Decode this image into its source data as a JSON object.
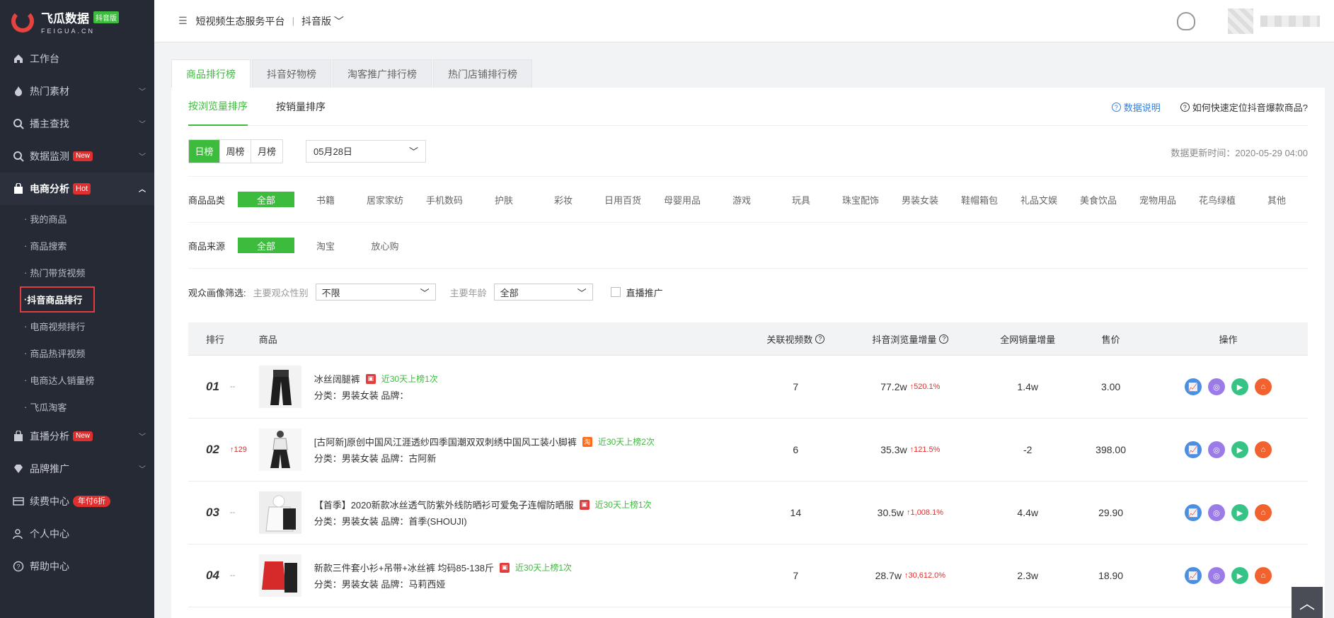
{
  "logo": {
    "title": "飞瓜数据",
    "badge": "抖音版",
    "sub": "FEIGUA.CN"
  },
  "sidebar": {
    "items": [
      {
        "label": "工作台",
        "icon": "home-icon"
      },
      {
        "label": "热门素材",
        "icon": "fire-icon"
      },
      {
        "label": "播主查找",
        "icon": "search-icon"
      },
      {
        "label": "数据监测",
        "icon": "monitor-icon",
        "badge": "New"
      },
      {
        "label": "电商分析",
        "icon": "bag-icon",
        "badge": "Hot"
      },
      {
        "label": "直播分析",
        "icon": "live-icon",
        "badge": "New"
      },
      {
        "label": "品牌推广",
        "icon": "diamond-icon"
      },
      {
        "label": "续费中心",
        "icon": "card-icon",
        "badge": "年付6折"
      },
      {
        "label": "个人中心",
        "icon": "user-icon"
      },
      {
        "label": "帮助中心",
        "icon": "help-icon"
      }
    ],
    "sub_items": [
      "我的商品",
      "商品搜索",
      "热门带货视频",
      "抖音商品排行",
      "电商视频排行",
      "商品热评视频",
      "电商达人销量榜",
      "飞瓜淘客"
    ]
  },
  "topbar": {
    "title": "短视频生态服务平台",
    "sep": "|",
    "version": "抖音版"
  },
  "tabs": [
    "商品排行榜",
    "抖音好物榜",
    "淘客推广排行榜",
    "热门店铺排行榜"
  ],
  "subtabs": [
    "按浏览量排序",
    "按销量排序"
  ],
  "help": {
    "data_note": "数据说明",
    "how_to": "如何快速定位抖音爆款商品?"
  },
  "period": {
    "options": [
      "日榜",
      "周榜",
      "月榜"
    ],
    "date": "05月28日",
    "update_time": "数据更新时间：2020-05-29 04:00"
  },
  "category": {
    "label": "商品品类",
    "options": [
      "全部",
      "书籍",
      "居家家纺",
      "手机数码",
      "护肤",
      "彩妆",
      "日用百货",
      "母婴用品",
      "游戏",
      "玩具",
      "珠宝配饰",
      "男装女装",
      "鞋帽箱包",
      "礼品文娱",
      "美食饮品",
      "宠物用品",
      "花鸟绿植",
      "其他"
    ]
  },
  "source": {
    "label": "商品来源",
    "options": [
      "全部",
      "淘宝",
      "放心购"
    ]
  },
  "audience": {
    "label": "观众画像筛选:",
    "gender_label": "主要观众性别",
    "gender_value": "不限",
    "age_label": "主要年龄",
    "age_value": "全部",
    "live_label": "直播推广"
  },
  "table": {
    "headers": {
      "rank": "排行",
      "product": "商品",
      "videos": "关联视频数",
      "views": "抖音浏览量增量",
      "sales": "全网销量增量",
      "price": "售价",
      "ops": "操作"
    },
    "rows": [
      {
        "rank": "01",
        "change": "--",
        "up": false,
        "title": "冰丝阔腿裤",
        "source": "放心购",
        "appear": "近30天上榜1次",
        "meta": "分类：男装女装 品牌：",
        "videos": "7",
        "views": "77.2w",
        "growth": "↑520.1%",
        "sales": "1.4w",
        "price": "3.00"
      },
      {
        "rank": "02",
        "change": "↑129",
        "up": true,
        "title": "[古阿新]原创中国风江涯透纱四季国潮双双刺绣中国风工装小脚裤",
        "source": "淘宝",
        "appear": "近30天上榜2次",
        "meta": "分类：男装女装 品牌：古阿新",
        "videos": "6",
        "views": "35.3w",
        "growth": "↑121.5%",
        "sales": "-2",
        "price": "398.00"
      },
      {
        "rank": "03",
        "change": "--",
        "up": false,
        "title": "【首季】2020新款冰丝透气防紫外线防晒衫可爱兔子连帽防晒服",
        "source": "放心购",
        "appear": "近30天上榜1次",
        "meta": "分类：男装女装 品牌：首季(SHOUJI)",
        "videos": "14",
        "views": "30.5w",
        "growth": "↑1,008.1%",
        "sales": "4.4w",
        "price": "29.90"
      },
      {
        "rank": "04",
        "change": "--",
        "up": false,
        "title": "新款三件套小衫+吊带+冰丝裤 均码85-138斤",
        "source": "放心购",
        "appear": "近30天上榜1次",
        "meta": "分类：男装女装 品牌：马莉西娅",
        "videos": "7",
        "views": "28.7w",
        "growth": "↑30,612.0%",
        "sales": "2.3w",
        "price": "18.90"
      }
    ]
  },
  "colors": {
    "accent": "#3dbb3d",
    "sidebar_bg": "#252a35",
    "hot": "#e02f2f"
  }
}
